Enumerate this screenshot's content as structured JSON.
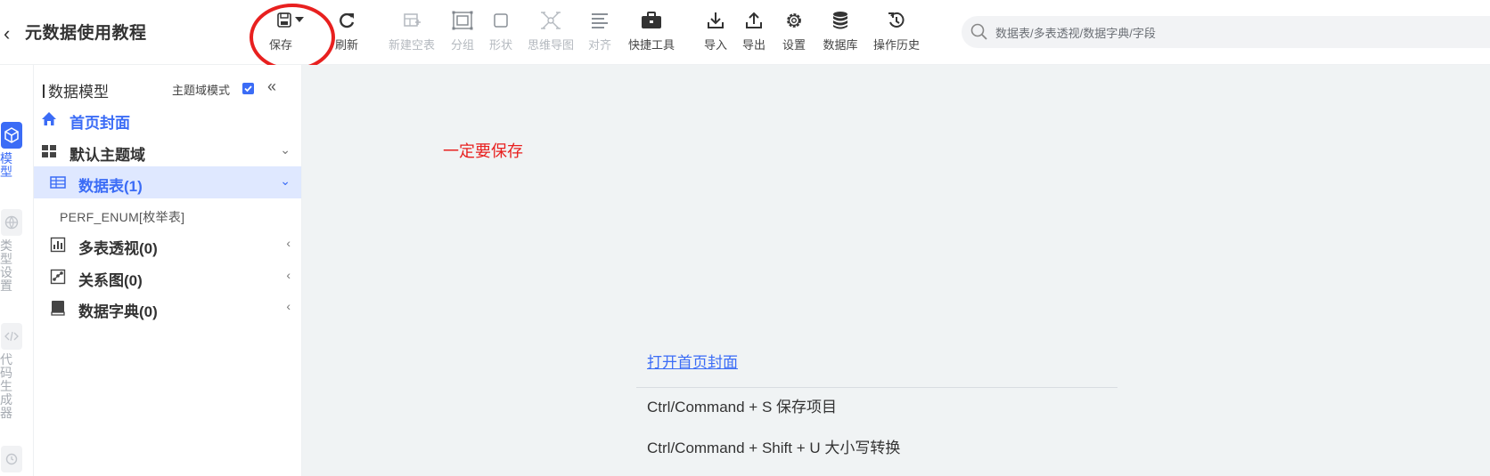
{
  "header": {
    "back_glyph": "‹",
    "title": "元数据使用教程"
  },
  "toolbar": {
    "save": "保存",
    "refresh": "刷新",
    "new_table": "新建空表",
    "group": "分组",
    "shape": "形状",
    "mindmap": "思维导图",
    "align": "对齐",
    "quick_tools": "快捷工具",
    "import": "导入",
    "export": "导出",
    "settings": "设置",
    "database": "数据库",
    "history": "操作历史"
  },
  "search": {
    "placeholder": "数据表/多表透视/数据字典/字段"
  },
  "rail": {
    "model": "模型",
    "type_settings": "类型设置",
    "code_generator": "代码生成器"
  },
  "panel": {
    "title": "数据模型",
    "theme_mode": "主题域模式",
    "theme_mode_checked": true,
    "collapse": "«",
    "items": {
      "home": "首页封面",
      "default_domain": "默认主题域",
      "tables": "数据表(1)",
      "table_child": "PERF_ENUM[枚举表]",
      "pivot": "多表透视(0)",
      "relation": "关系图(0)",
      "dictionary": "数据字典(0)"
    }
  },
  "canvas": {
    "annotation": "一定要保存",
    "open_home_link": "打开首页封面",
    "shortcuts": [
      "Ctrl/Command + S 保存项目",
      "Ctrl/Command + Shift + U 大小写转换"
    ]
  },
  "colors": {
    "accent": "#3b6cf6",
    "annotation_red": "#e8201f",
    "canvas_bg": "#f0f3f4",
    "selected_row_bg": "#dfe8ff"
  }
}
